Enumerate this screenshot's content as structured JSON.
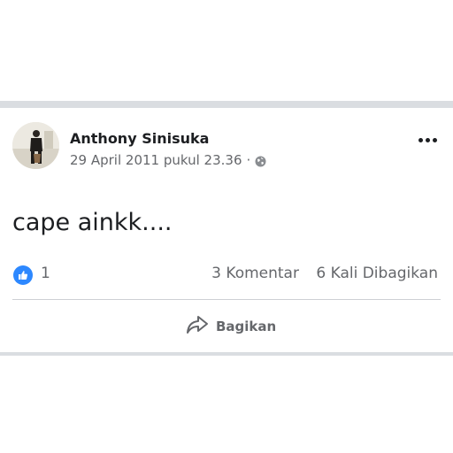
{
  "post": {
    "author": "Anthony Sinisuka",
    "timestamp": "29 April 2011 pukul 23.36",
    "separator": "·",
    "privacy_icon": "globe-icon",
    "text": "cape ainkk....",
    "reactions": {
      "icon": "like-icon",
      "count": "1"
    },
    "comments": "3 Komentar",
    "shares": "6 Kali Dibagikan",
    "actions": {
      "share_label": "Bagikan",
      "share_icon": "share-arrow-icon"
    },
    "more_icon": "more-options-icon"
  },
  "colors": {
    "like_blue": "#2d88ff",
    "text_primary": "#1c1e21",
    "text_secondary": "#65676b",
    "divider": "#dadde1"
  }
}
